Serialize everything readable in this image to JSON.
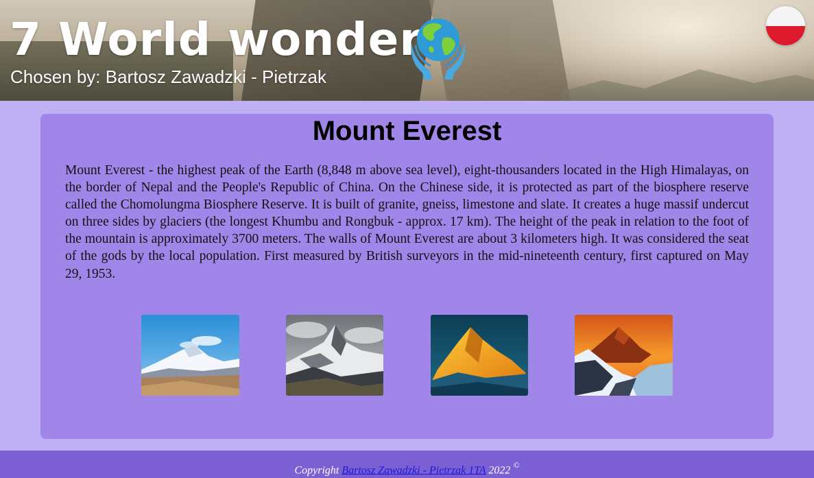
{
  "header": {
    "title": "7 World wonders",
    "subtitle": "Chosen by: Bartosz Zawadzki - Pietrzak",
    "logo_icon": "globe-in-hands-icon",
    "language_flag": "poland-flag-icon"
  },
  "main": {
    "title": "Mount Everest",
    "description": "Mount Everest - the highest peak of the Earth (8,848 m above sea level), eight-thousanders located in the High Himalayas, on the border of Nepal and the People's Republic of China. On the Chinese side, it is protected as part of the biosphere reserve called the Chomolungma Biosphere Reserve. It is built of granite, gneiss, limestone and slate. It creates a huge massif undercut on three sides by glaciers (the longest Khumbu and Rongbuk - approx. 17 km). The height of the peak in relation to the foot of the mountain is approximately 3700 meters. The walls of Mount Everest are about 3 kilometers high. It was considered the seat of the gods by the local population. First measured by British surveyors in the mid-nineteenth century, first captured on May 29, 1953.",
    "gallery_count": 4
  },
  "footer": {
    "prefix": "Copyright",
    "author_link": "Bartosz Zawadzki - Pietrzak 1TA",
    "year": "2022",
    "symbol": "©"
  },
  "colors": {
    "page_bg": "#bfaff5",
    "card_bg": "#a186ea",
    "footer_bg": "#7c5fd2",
    "link": "#1a1ad8"
  }
}
